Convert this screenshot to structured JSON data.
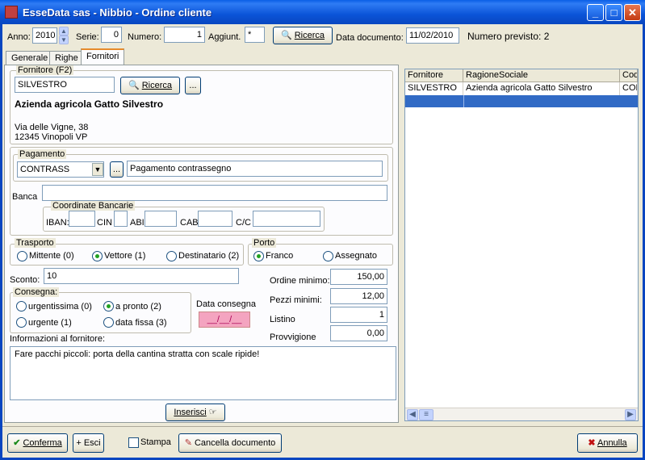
{
  "window": {
    "title": "EsseData sas - Nibbio - Ordine cliente",
    "minimize": "_",
    "maximize": "□",
    "close": "✕"
  },
  "header": {
    "anno_label": "Anno:",
    "anno_value": "2010",
    "serie_label": "Serie:",
    "serie_value": "0",
    "numero_label": "Numero:",
    "numero_value": "1",
    "aggiunt_label": "Aggiunt.",
    "aggiunt_value": "*",
    "ricerca_label": "Ricerca",
    "data_label": "Data documento:",
    "data_value": "11/02/2010",
    "numero_previsto": "Numero previsto: 2"
  },
  "tabs": [
    {
      "label": "Generale"
    },
    {
      "label": "Righe"
    },
    {
      "label": "Fornitori"
    }
  ],
  "fornitore": {
    "group_label": "Fornitore (F2)",
    "code_value": "SILVESTRO",
    "ricerca_label": "Ricerca",
    "ellipsis": "...",
    "name": "Azienda agricola Gatto Silvestro",
    "address1": "Via delle Vigne, 38",
    "address2": "12345 Vinopoli VP"
  },
  "pagamento": {
    "group_label": "Pagamento",
    "code_value": "CONTRASS",
    "ellipsis": "...",
    "description": "Pagamento contrassegno"
  },
  "banca": {
    "label": "Banca",
    "value": "",
    "coord_label": "Coordinate Bancarie",
    "iban_label": "IBAN:",
    "cin_label": "CIN",
    "abi_label": "ABI",
    "cab_label": "CAB",
    "cc_label": "C/C"
  },
  "trasporto": {
    "group_label": "Trasporto",
    "options": [
      "Mittente (0)",
      "Vettore (1)",
      "Destinatario (2)"
    ],
    "selected": 1
  },
  "porto": {
    "group_label": "Porto",
    "options": [
      "Franco",
      "Assegnato"
    ],
    "selected": 0
  },
  "sconto": {
    "label": "Sconto:",
    "value": "10"
  },
  "consegna": {
    "group_label": "Consegna:",
    "options": [
      "urgentissima (0)",
      "a pronto (2)",
      "urgente (1)",
      "data fissa (3)"
    ],
    "selected": 1,
    "data_label": "Data consegna",
    "data_value": "__/__/__"
  },
  "ordini": {
    "ordine_minimo_label": "Ordine minimo:",
    "ordine_minimo": "150,00",
    "pezzi_minimi_label": "Pezzi minimi:",
    "pezzi_minimi": "12,00",
    "listino_label": "Listino",
    "listino": "1",
    "provvigione_label": "Provvigione",
    "provvigione": "0,00"
  },
  "info": {
    "label": "Informazioni al fornitore:",
    "text": "Fare pacchi piccoli: porta della cantina stratta con scale ripide!"
  },
  "inserisci_label": "Inserisci",
  "grid": {
    "columns": [
      "Fornitore",
      "RagioneSociale",
      "Cod"
    ],
    "rows": [
      [
        "SILVESTRO",
        "Azienda agricola Gatto Silvestro",
        "CON"
      ]
    ]
  },
  "footer": {
    "conferma": "Conferma",
    "esci": "+ Esci",
    "stampa": "Stampa",
    "cancella": "Cancella documento",
    "annulla": "Annulla"
  }
}
